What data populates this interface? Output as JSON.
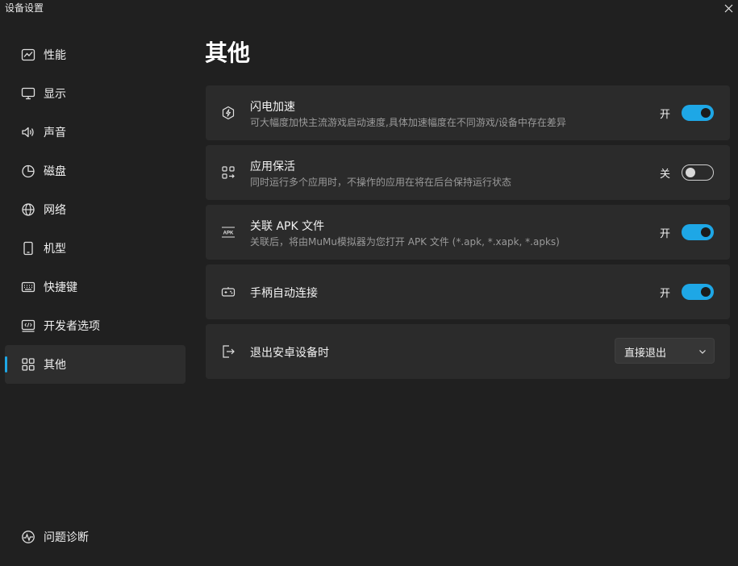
{
  "window": {
    "title": "设备设置"
  },
  "sidebar": {
    "items": [
      {
        "label": "性能",
        "icon": "chart-line-icon"
      },
      {
        "label": "显示",
        "icon": "monitor-icon"
      },
      {
        "label": "声音",
        "icon": "speaker-icon"
      },
      {
        "label": "磁盘",
        "icon": "pie-chart-icon"
      },
      {
        "label": "网络",
        "icon": "globe-icon"
      },
      {
        "label": "机型",
        "icon": "phone-icon"
      },
      {
        "label": "快捷键",
        "icon": "keyboard-icon"
      },
      {
        "label": "开发者选项",
        "icon": "code-icon"
      },
      {
        "label": "其他",
        "icon": "grid-icon"
      }
    ],
    "active_index": 8,
    "diagnostics": {
      "label": "问题诊断",
      "icon": "diagnostics-icon"
    }
  },
  "main": {
    "title": "其他",
    "settings": [
      {
        "title": "闪电加速",
        "description": "可大幅度加快主流游戏启动速度,具体加速幅度在不同游戏/设备中存在差异",
        "state_label": "开",
        "enabled": true,
        "icon": "lightning-icon"
      },
      {
        "title": "应用保活",
        "description": "同时运行多个应用时，不操作的应用在将在后台保持运行状态",
        "state_label": "关",
        "enabled": false,
        "icon": "apps-arrow-icon"
      },
      {
        "title": "关联 APK 文件",
        "description": "关联后，将由MuMu模拟器为您打开 APK 文件 (*.apk, *.xapk, *.apks)",
        "state_label": "开",
        "enabled": true,
        "icon": "apk-icon",
        "icon_text": "APK"
      },
      {
        "title": "手柄自动连接",
        "state_label": "开",
        "enabled": true,
        "icon": "gamepad-icon"
      },
      {
        "title": "退出安卓设备时",
        "select_value": "直接退出",
        "icon": "exit-icon"
      }
    ]
  },
  "colors": {
    "background": "#202020",
    "card": "#2b2b2b",
    "accent": "#1ea7e6",
    "active_nav": "#2d2d2d"
  }
}
